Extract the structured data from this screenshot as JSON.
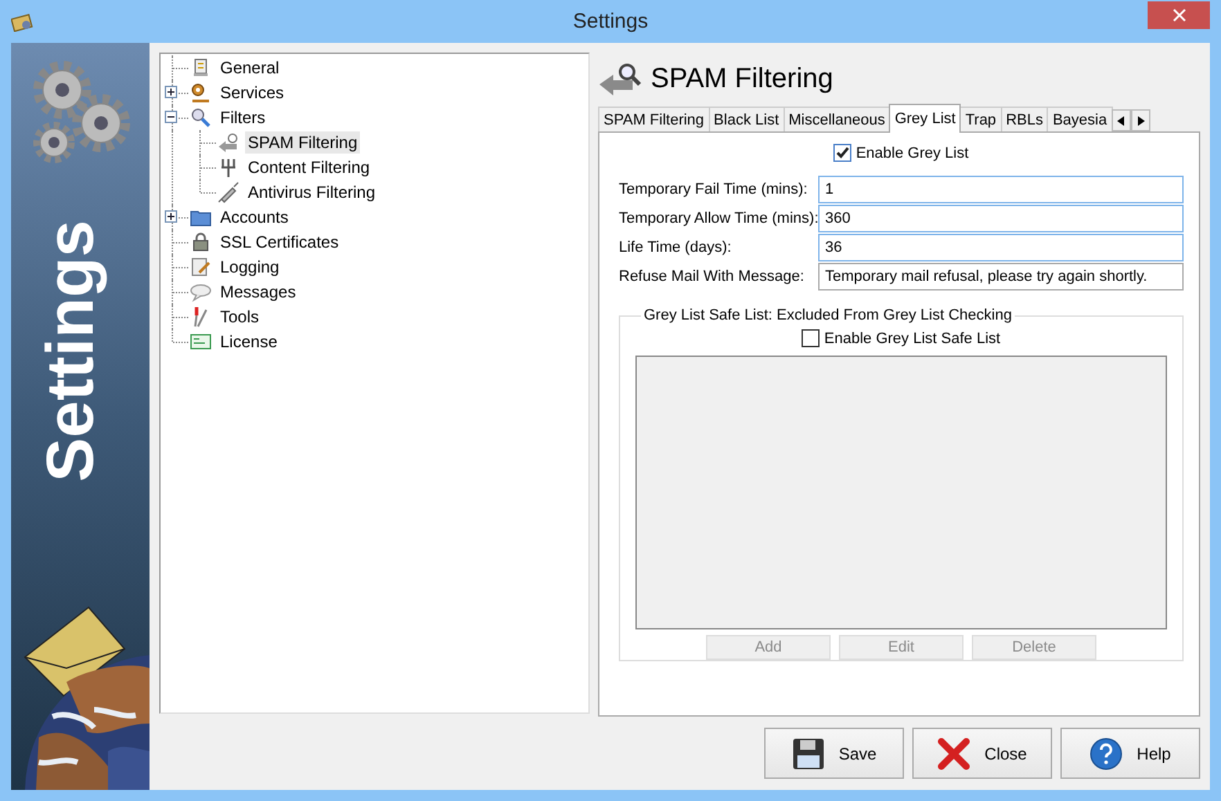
{
  "window": {
    "title": "Settings"
  },
  "banner": {
    "title": "Settings"
  },
  "tree": [
    {
      "label": "General",
      "selected": false
    },
    {
      "label": "Services",
      "selected": false,
      "expanded": false
    },
    {
      "label": "Filters",
      "selected": false,
      "expanded": true,
      "children": [
        {
          "label": "SPAM Filtering",
          "selected": true
        },
        {
          "label": "Content Filtering",
          "selected": false
        },
        {
          "label": "Antivirus Filtering",
          "selected": false
        }
      ]
    },
    {
      "label": "Accounts",
      "selected": false,
      "expanded": false
    },
    {
      "label": "SSL Certificates",
      "selected": false
    },
    {
      "label": "Logging",
      "selected": false
    },
    {
      "label": "Messages",
      "selected": false
    },
    {
      "label": "Tools",
      "selected": false
    },
    {
      "label": "License",
      "selected": false
    }
  ],
  "page": {
    "title": "SPAM Filtering"
  },
  "tabs": [
    {
      "label": "SPAM Filtering",
      "selected": false
    },
    {
      "label": "Black List",
      "selected": false
    },
    {
      "label": "Miscellaneous",
      "selected": false
    },
    {
      "label": "Grey List",
      "selected": true
    },
    {
      "label": "Trap",
      "selected": false
    },
    {
      "label": "RBLs",
      "selected": false
    },
    {
      "label": "Bayesia",
      "selected": false
    }
  ],
  "grey_list": {
    "enable": {
      "label": "Enable Grey List",
      "checked": true
    },
    "fields": [
      {
        "label": "Temporary Fail Time (mins):",
        "value": "1"
      },
      {
        "label": "Temporary Allow Time (mins):",
        "value": "360"
      },
      {
        "label": "Life Time (days):",
        "value": "36"
      },
      {
        "label": "Refuse Mail With Message:",
        "value": "Temporary mail refusal, please try again shortly."
      }
    ],
    "safe_list": {
      "title": "Grey List Safe List: Excluded From Grey List Checking",
      "enable": {
        "label": "Enable Grey List Safe List",
        "checked": false
      },
      "buttons": [
        {
          "label": "Add",
          "disabled": true
        },
        {
          "label": "Edit",
          "disabled": true
        },
        {
          "label": "Delete",
          "disabled": true
        }
      ]
    }
  },
  "buttons": [
    {
      "label": "Save"
    },
    {
      "label": "Close"
    },
    {
      "label": "Help"
    }
  ]
}
